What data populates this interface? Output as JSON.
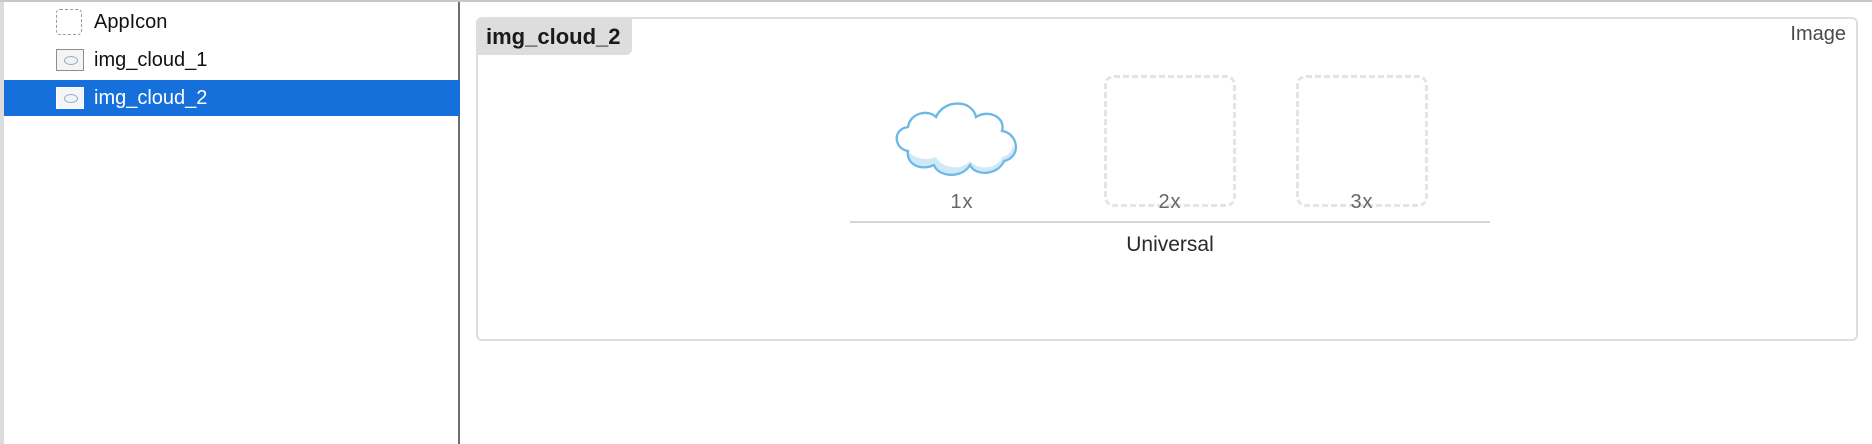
{
  "sidebar": {
    "items": [
      {
        "label": "AppIcon",
        "icon": "app-icon-placeholder",
        "selected": false
      },
      {
        "label": "img_cloud_1",
        "icon": "image-thumbnail-icon",
        "selected": false
      },
      {
        "label": "img_cloud_2",
        "icon": "image-thumbnail-icon",
        "selected": true
      }
    ]
  },
  "asset": {
    "name": "img_cloud_2",
    "type_label": "Image",
    "slots": [
      {
        "label": "1x",
        "filled": true,
        "icon": "cloud-image"
      },
      {
        "label": "2x",
        "filled": false
      },
      {
        "label": "3x",
        "filled": false
      }
    ],
    "group_label": "Universal"
  },
  "colors": {
    "selection": "#1670dc",
    "cloud_fill": "#ffffff",
    "cloud_shade": "#cfe9f7",
    "cloud_stroke": "#6cb9e6"
  }
}
